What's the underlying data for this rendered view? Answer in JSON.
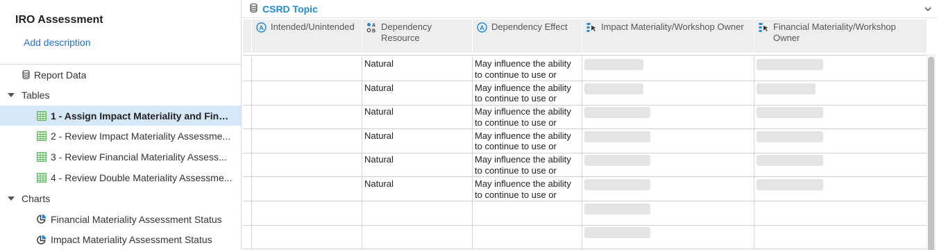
{
  "sidebar": {
    "title": "IRO Assessment",
    "add_description": "Add description",
    "report_data": "Report Data",
    "tables_label": "Tables",
    "tables": [
      "1 - Assign Impact Materiality and Finan...",
      "2 - Review Impact Materiality Assessme...",
      "3 - Review Financial Materiality Assess...",
      "4 - Review Double Materiality Assessme..."
    ],
    "charts_label": "Charts",
    "charts": [
      "Financial Materiality Assessment Status",
      "Impact Materiality Assessment Status"
    ]
  },
  "main": {
    "topic": "CSRD Topic",
    "columns": [
      {
        "label": "Intended/Unintended",
        "icon": "choice-a-icon"
      },
      {
        "label": "Dependency Resource",
        "icon": "multi-choice-icon"
      },
      {
        "label": "Dependency Effect",
        "icon": "choice-a-icon"
      },
      {
        "label": "Impact Materiality/Workshop Owner",
        "icon": "user-picker-icon"
      },
      {
        "label": "Financial Materiality/Workshop Owner",
        "icon": "user-picker-icon"
      }
    ],
    "rows": [
      {
        "resource": "Natural",
        "effect_line1": "May influence the ability",
        "effect_line2": "to continue to use or",
        "owner_pill": 0.85,
        "fin_pill": 0.96
      },
      {
        "resource": "Natural",
        "effect_line1": "May influence the ability",
        "effect_line2": "to continue to use or",
        "owner_pill": 0.85,
        "fin_pill": 0.85
      },
      {
        "resource": "Natural",
        "effect_line1": "May influence the ability",
        "effect_line2": "to continue to use or",
        "owner_pill": 0.95,
        "fin_pill": 0.96
      },
      {
        "resource": "Natural",
        "effect_line1": "May influence the ability",
        "effect_line2": "to continue to use or",
        "owner_pill": 0.95,
        "fin_pill": 0.96
      },
      {
        "resource": "Natural",
        "effect_line1": "May influence the ability",
        "effect_line2": "to continue to use or",
        "owner_pill": 0.95,
        "fin_pill": 0.96
      },
      {
        "resource": "Natural",
        "effect_line1": "May influence the ability",
        "effect_line2": "to continue to use or",
        "owner_pill": 0.95,
        "fin_pill": 0.96
      },
      {
        "resource": "",
        "effect_line1": "",
        "effect_line2": "",
        "owner_pill": 0.95,
        "fin_pill": 0
      },
      {
        "resource": "",
        "effect_line1": "",
        "effect_line2": "",
        "owner_pill": 0.95,
        "fin_pill": 0
      }
    ]
  },
  "colors": {
    "accent": "#1f8ad8",
    "link": "#1f6fcf",
    "selected": "#d6e8f8",
    "table_icon": "#5cb85c"
  }
}
